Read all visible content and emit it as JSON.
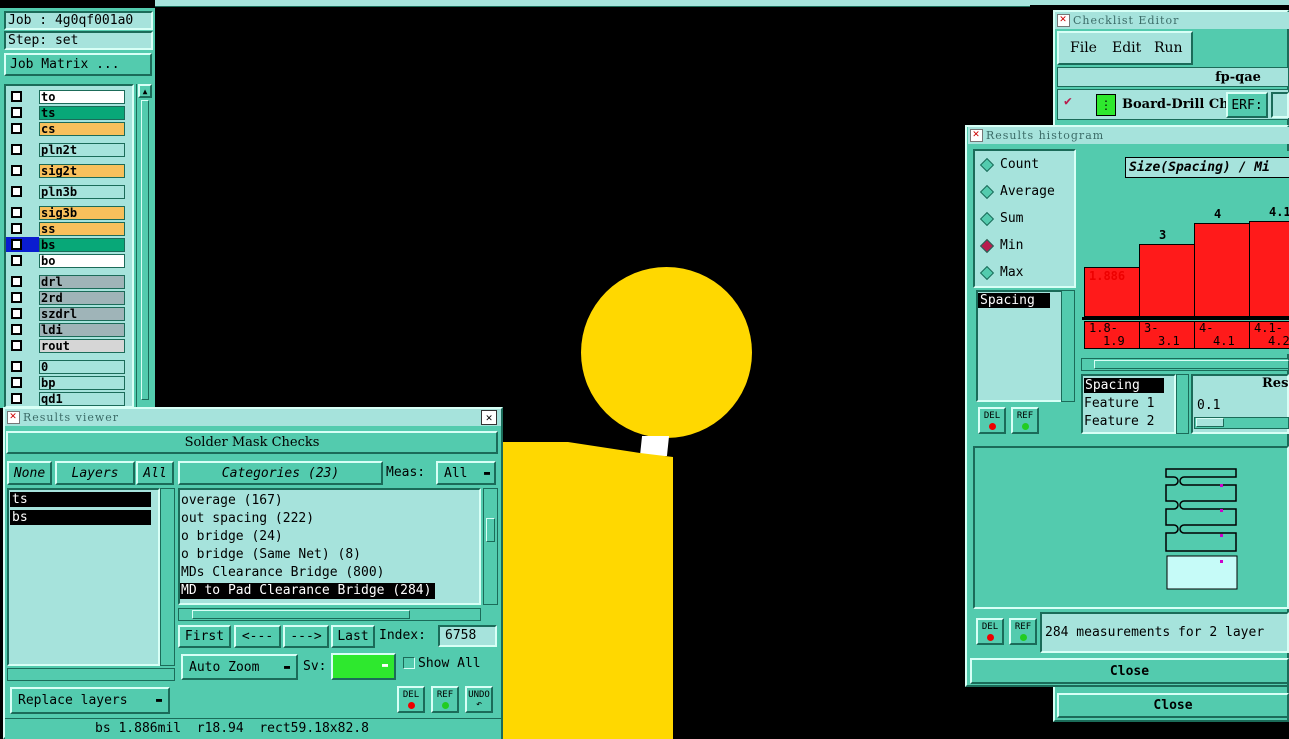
{
  "job_panel": {
    "job": "Job : 4g0qf001a0",
    "step": "Step: set",
    "job_matrix_button": "Job Matrix ..."
  },
  "layers": [
    {
      "name": "to",
      "color": "#ffffff"
    },
    {
      "name": "ts",
      "color": "#08a878"
    },
    {
      "name": "cs",
      "color": "#f8c05c"
    },
    {
      "name": "pln2t",
      "color": "#a6e3dc"
    },
    {
      "name": "sig2t",
      "color": "#f8c05c"
    },
    {
      "name": "pln3b",
      "color": "#a6e3dc"
    },
    {
      "name": "sig3b",
      "color": "#f8c05c"
    },
    {
      "name": "ss",
      "color": "#f8c05c"
    },
    {
      "name": "bs",
      "color": "#08a878"
    },
    {
      "name": "bo",
      "color": "#ffffff"
    },
    {
      "name": "drl",
      "color": "#9fb4b8"
    },
    {
      "name": "2rd",
      "color": "#9fb4b8"
    },
    {
      "name": "szdrl",
      "color": "#9fb4b8"
    },
    {
      "name": "ldi",
      "color": "#9fb4b8"
    },
    {
      "name": "rout",
      "color": "#d6d6d6"
    },
    {
      "name": "0",
      "color": "#a6e3dc"
    },
    {
      "name": "bp",
      "color": "#a6e3dc"
    },
    {
      "name": "qd1",
      "color": "#a6e3dc"
    }
  ],
  "results_viewer": {
    "title": "Results viewer",
    "close_glyph": "✕",
    "header": "Solder Mask Checks",
    "none_btn": "None",
    "layers_btn": "Layers",
    "all_btn": "All",
    "selected_layers": [
      "ts",
      "bs"
    ],
    "categories_btn": "Categories (23)",
    "meas_label": "Meas:",
    "meas_value": "All",
    "categories": [
      "overage (167)",
      "out spacing (222)",
      "o bridge (24)",
      "o bridge (Same Net) (8)",
      "MDs Clearance Bridge (800)",
      "MD to Pad Clearance Bridge (284)"
    ],
    "first_btn": "First",
    "prev_btn": "<---",
    "next_btn": "--->",
    "last_btn": "Last",
    "index_label": "Index:",
    "index_value": "6758",
    "auto_zoom": "Auto Zoom",
    "sv_label": "Sv:",
    "show_all": "Show All",
    "replace_layers": "Replace layers",
    "del": "DEL",
    "ref": "REF",
    "undo": "UNDO",
    "status": "bs 1.886mil  r18.94  rect59.18x82.8"
  },
  "checklist_editor": {
    "title": "Checklist Editor",
    "menu": [
      "File",
      "Edit",
      "Run"
    ],
    "checklist_name": "fp-qae",
    "row_label": "Board-Drill Che",
    "erf_btn": "ERF:",
    "close": "Close"
  },
  "histogram": {
    "title": "Results histogram",
    "options": [
      "Count",
      "Average",
      "Sum",
      "Min",
      "Max"
    ],
    "selected_option": "Min",
    "measure_item": "Spacing",
    "chart_title": "Size(Spacing) / Mi",
    "bar_values": [
      "1.886",
      "3",
      "4",
      "4.1"
    ],
    "bar_levels": [
      1.886,
      3,
      4,
      4.1
    ],
    "bins": [
      {
        "top": "1.8-",
        "bottom": "1.9"
      },
      {
        "top": "3-",
        "bottom": "3.1"
      },
      {
        "top": "4-",
        "bottom": "4.1"
      },
      {
        "top": "4.1-",
        "bottom": "4.2"
      }
    ],
    "fields": [
      "Spacing",
      "Feature 1",
      "Feature 2"
    ],
    "res_label": "Res",
    "res_value": "0.1",
    "summary": "284 measurements for 2 layer",
    "close": "Close",
    "del": "DEL",
    "ref": "REF"
  }
}
